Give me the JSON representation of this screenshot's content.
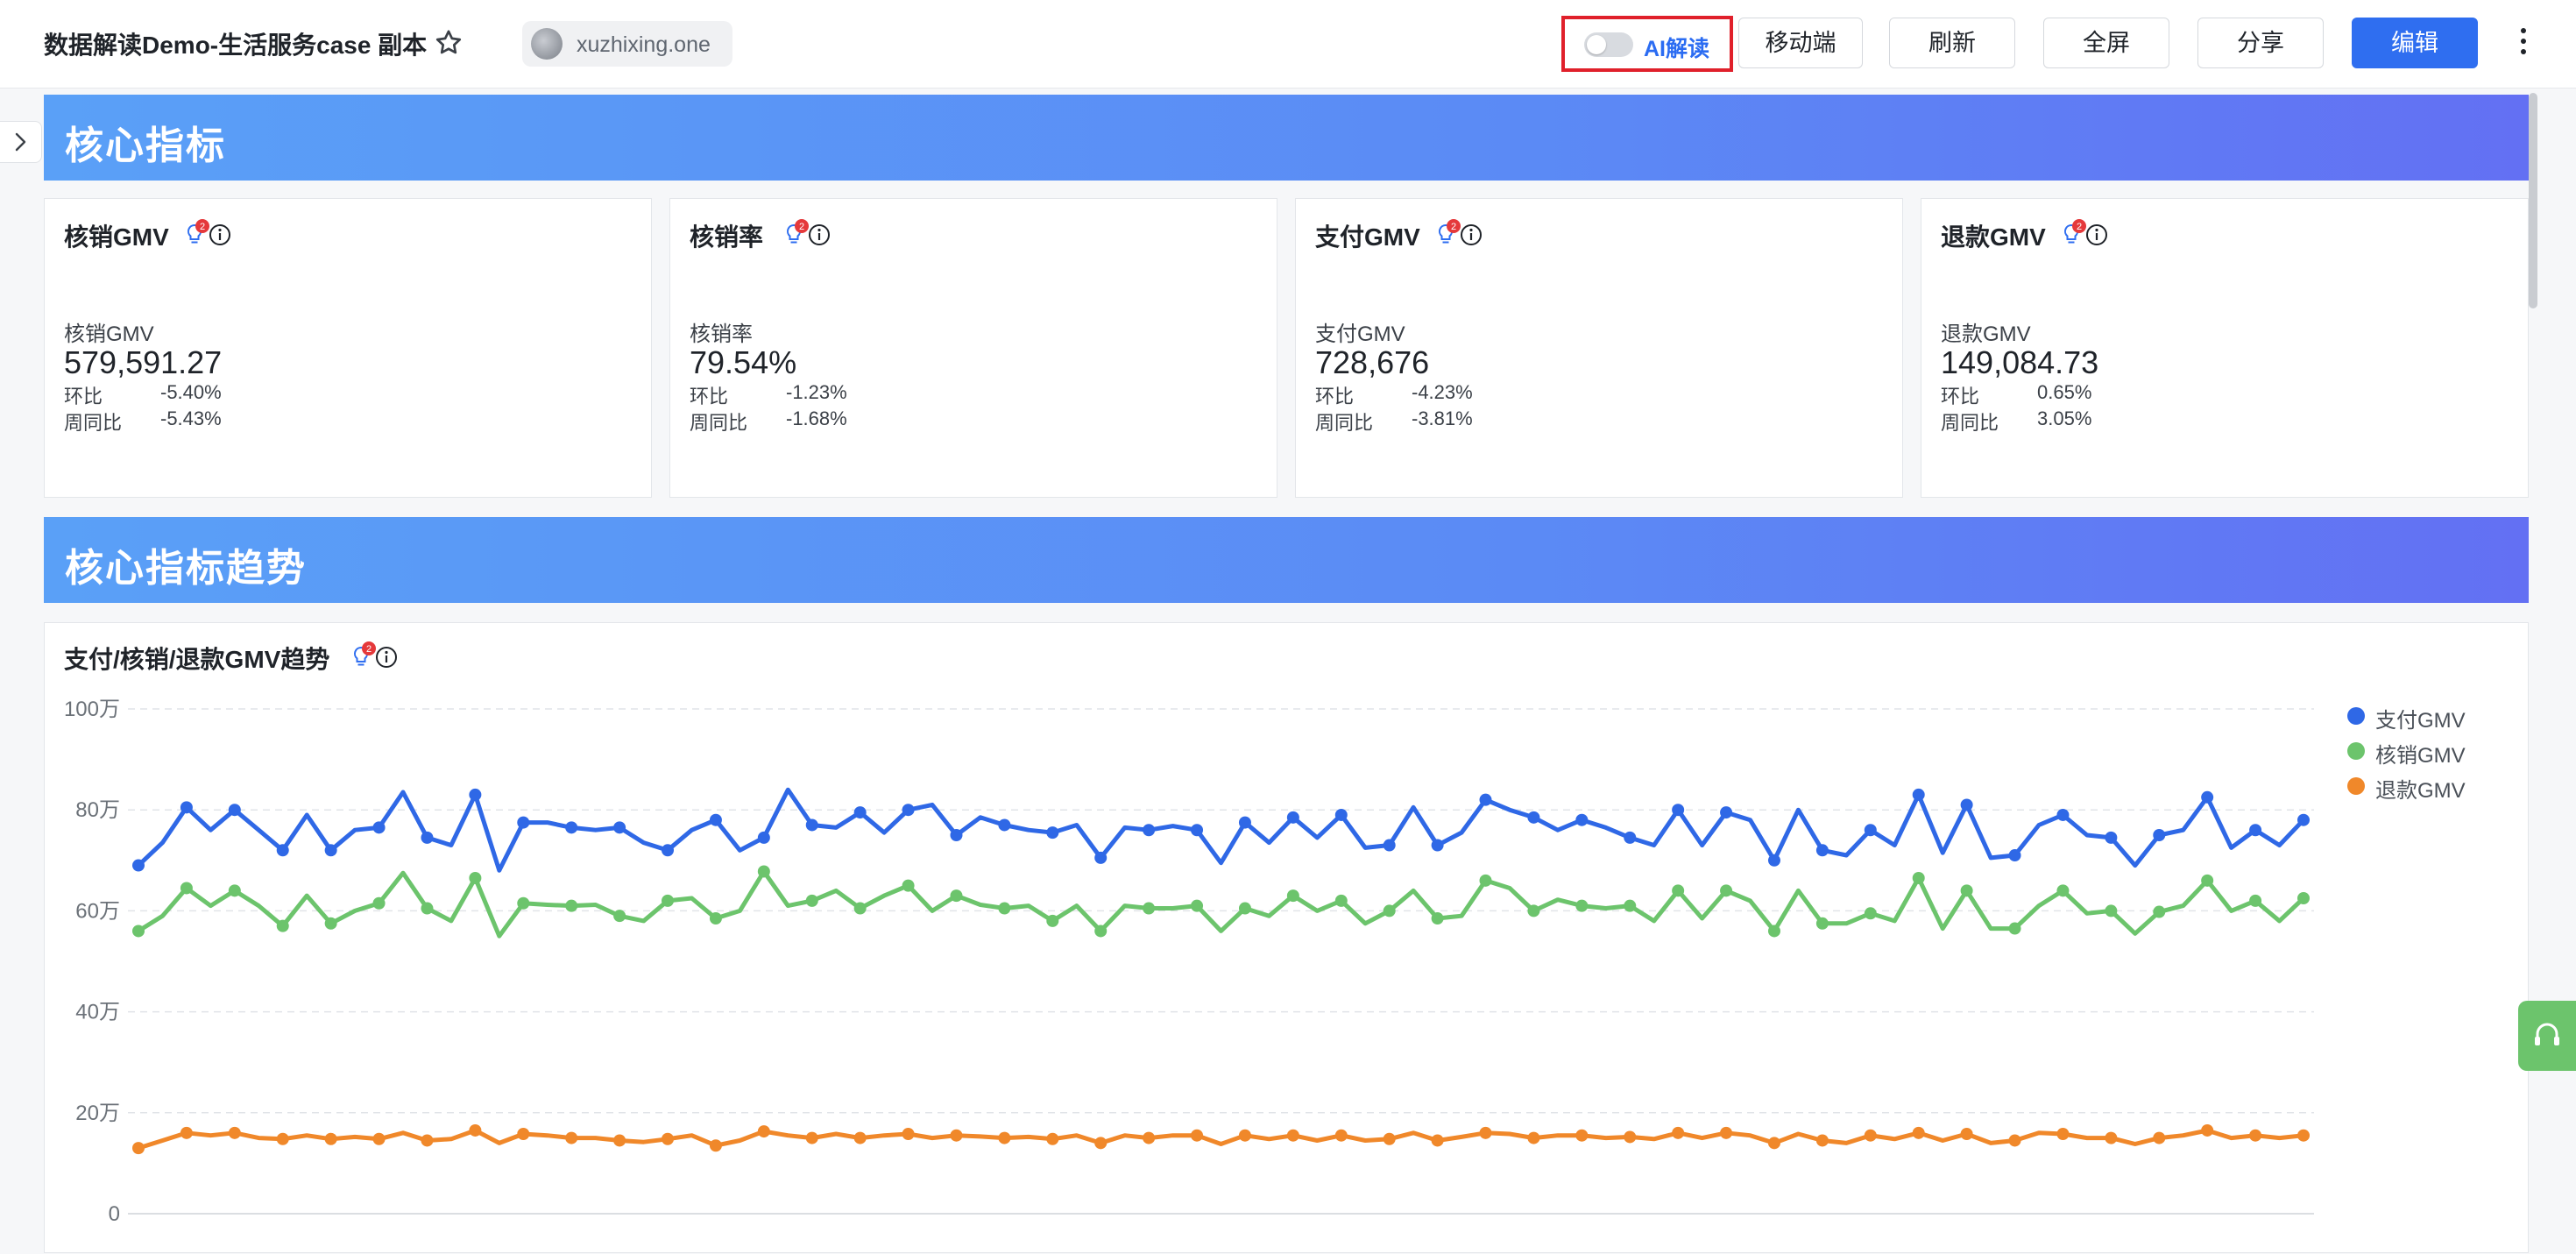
{
  "header": {
    "title": "数据解读Demo-生活服务case 副本",
    "owner": "xuzhixing.one",
    "ai_label": "AI解读",
    "buttons": [
      "移动端",
      "刷新",
      "全屏",
      "分享",
      "编辑"
    ]
  },
  "sections": {
    "core": "核心指标",
    "trend": "核心指标趋势"
  },
  "badge_count": "2",
  "cards": [
    {
      "title": "核销GMV",
      "metric_label": "核销GMV",
      "value": "579,591.27",
      "hb_label": "环比",
      "hb": "-5.40%",
      "zt_label": "周同比",
      "zt": "-5.43%"
    },
    {
      "title": "核销率",
      "metric_label": "核销率",
      "value": "79.54%",
      "hb_label": "环比",
      "hb": "-1.23%",
      "zt_label": "周同比",
      "zt": "-1.68%"
    },
    {
      "title": "支付GMV",
      "metric_label": "支付GMV",
      "value": "728,676",
      "hb_label": "环比",
      "hb": "-4.23%",
      "zt_label": "周同比",
      "zt": "-3.81%"
    },
    {
      "title": "退款GMV",
      "metric_label": "退款GMV",
      "value": "149,084.73",
      "hb_label": "环比",
      "hb": "0.65%",
      "zt_label": "周同比",
      "zt": "3.05%"
    }
  ],
  "panel": {
    "title": "支付/核销/退款GMV趋势"
  },
  "colors": {
    "pay": "#2f68e6",
    "verify": "#6cc46c",
    "refund": "#f0882a",
    "accent": "#2f6ef0"
  },
  "chart_data": {
    "type": "line",
    "title": "支付/核销/退款GMV趋势",
    "y_ticks": [
      "0",
      "20万",
      "40万",
      "60万",
      "80万",
      "100万"
    ],
    "ylim": [
      0,
      1000000
    ],
    "grid": true,
    "legend_position": "right",
    "series": [
      {
        "name": "支付GMV",
        "values": [
          690000,
          735000,
          805000,
          760000,
          800000,
          760000,
          720000,
          790000,
          720000,
          760000,
          765000,
          835000,
          745000,
          730000,
          830000,
          680000,
          775000,
          775000,
          765000,
          760000,
          765000,
          735000,
          720000,
          760000,
          780000,
          720000,
          745000,
          840000,
          770000,
          765000,
          795000,
          755000,
          800000,
          810000,
          750000,
          785000,
          770000,
          760000,
          755000,
          770000,
          705000,
          765000,
          760000,
          768000,
          760000,
          695000,
          775000,
          735000,
          785000,
          745000,
          790000,
          725000,
          730000,
          805000,
          730000,
          755000,
          820000,
          800000,
          785000,
          760000,
          780000,
          765000,
          745000,
          730000,
          800000,
          730000,
          795000,
          780000,
          700000,
          800000,
          720000,
          710000,
          760000,
          730000,
          830000,
          715000,
          810000,
          705000,
          710000,
          770000,
          790000,
          750000,
          745000,
          690000,
          750000,
          760000,
          825000,
          725000,
          760000,
          730000,
          780000
        ]
      },
      {
        "name": "核销GMV",
        "values": [
          560000,
          590000,
          645000,
          610000,
          640000,
          610000,
          570000,
          630000,
          575000,
          600000,
          615000,
          675000,
          605000,
          580000,
          665000,
          550000,
          615000,
          612000,
          610000,
          612000,
          590000,
          580000,
          620000,
          625000,
          585000,
          600000,
          678000,
          610000,
          620000,
          640000,
          605000,
          630000,
          650000,
          600000,
          630000,
          612000,
          605000,
          610000,
          580000,
          610000,
          560000,
          610000,
          605000,
          605000,
          610000,
          560000,
          605000,
          590000,
          630000,
          600000,
          620000,
          575000,
          600000,
          640000,
          585000,
          590000,
          660000,
          645000,
          600000,
          622000,
          610000,
          605000,
          610000,
          580000,
          640000,
          585000,
          640000,
          620000,
          560000,
          640000,
          575000,
          575000,
          595000,
          580000,
          665000,
          565000,
          640000,
          565000,
          565000,
          610000,
          640000,
          595000,
          600000,
          555000,
          598000,
          610000,
          660000,
          600000,
          620000,
          580000,
          625000
        ]
      },
      {
        "name": "退款GMV",
        "values": [
          130000,
          145000,
          160000,
          155000,
          160000,
          150000,
          148000,
          155000,
          148000,
          152000,
          148000,
          160000,
          145000,
          148000,
          165000,
          140000,
          158000,
          155000,
          150000,
          150000,
          145000,
          142000,
          148000,
          155000,
          135000,
          145000,
          163000,
          155000,
          150000,
          158000,
          150000,
          155000,
          158000,
          150000,
          155000,
          153000,
          150000,
          152000,
          148000,
          155000,
          140000,
          155000,
          150000,
          155000,
          155000,
          138000,
          155000,
          148000,
          155000,
          145000,
          155000,
          145000,
          148000,
          160000,
          145000,
          152000,
          160000,
          158000,
          150000,
          155000,
          155000,
          150000,
          152000,
          148000,
          160000,
          150000,
          160000,
          155000,
          140000,
          158000,
          145000,
          140000,
          155000,
          148000,
          160000,
          145000,
          158000,
          140000,
          145000,
          160000,
          158000,
          150000,
          150000,
          138000,
          150000,
          155000,
          165000,
          150000,
          155000,
          150000,
          155000
        ]
      }
    ]
  }
}
